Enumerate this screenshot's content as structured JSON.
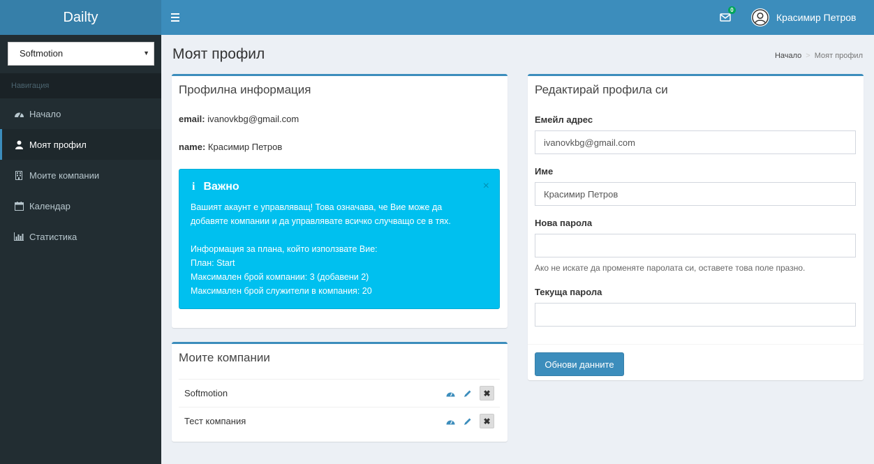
{
  "app": {
    "title": "Dailty"
  },
  "header": {
    "notifications_count": "0",
    "user_name": "Красимир Петров"
  },
  "sidebar": {
    "company_selected": "Softmotion",
    "nav_header": "Навигация",
    "items": [
      {
        "label": "Начало",
        "icon": "dashboard-icon"
      },
      {
        "label": "Моят профил",
        "icon": "user-icon",
        "active": true
      },
      {
        "label": "Моите компании",
        "icon": "building-icon"
      },
      {
        "label": "Календар",
        "icon": "calendar-icon"
      },
      {
        "label": "Статистика",
        "icon": "bar-chart-icon"
      }
    ]
  },
  "page": {
    "title": "Моят профил",
    "breadcrumb": {
      "home": "Начало",
      "current": "Моят профил"
    }
  },
  "profile_info": {
    "title": "Профилна информация",
    "email_label": "email:",
    "email_value": "ivanovkbg@gmail.com",
    "name_label": "name:",
    "name_value": "Красимир Петров",
    "alert": {
      "title": "Важно",
      "line1": "Вашият акаунт е управляващ! Това означава, че Вие може да",
      "line2": "добавяте компании и да управлявате всичко случващо се в тях.",
      "line3": "Информация за плана, който използвате Вие:",
      "line4": "План: Start",
      "line5": "Максимален брой компании: 3 (добавени 2)",
      "line6": "Максимален брой служители в компания: 20",
      "close": "×"
    }
  },
  "companies": {
    "title": "Моите компании",
    "rows": [
      {
        "name": "Softmotion"
      },
      {
        "name": "Тест компания"
      }
    ]
  },
  "edit_profile": {
    "title": "Редактирай профила си",
    "email_label": "Емейл адрес",
    "email_value": "ivanovkbg@gmail.com",
    "name_label": "Име",
    "name_value": "Красимир Петров",
    "new_password_label": "Нова парола",
    "new_password_help": "Ако не искате да променяте паролата си, оставете това поле празно.",
    "current_password_label": "Текуща парола",
    "submit_label": "Обнови данните"
  },
  "colors": {
    "accent": "#3c8dbc",
    "sidebar_bg": "#222d32",
    "alert_info": "#00c0ef",
    "badge_success": "#00a65a"
  }
}
